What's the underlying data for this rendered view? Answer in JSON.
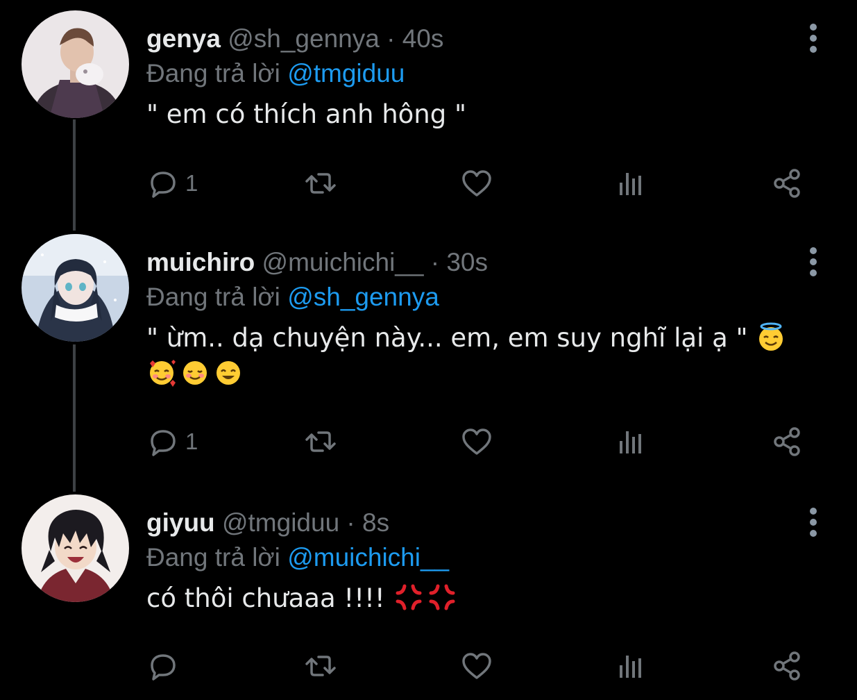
{
  "colors": {
    "background": "#000000",
    "text_primary": "#e7e9ea",
    "text_secondary": "#71767b",
    "accent": "#1d9bf0",
    "thread_line": "#3d4145"
  },
  "tweets": [
    {
      "name": "genya",
      "handle": "@sh_gennya",
      "sep": " · ",
      "time": "40s",
      "replying_label": "Đang trả lời ",
      "replying_to": "@tmgiduu",
      "text": "\" em có thích anh hông \"",
      "emojis": [],
      "reply_count": "1",
      "avatar_icon": "avatar-genya"
    },
    {
      "name": "muichiro",
      "handle": "@muichichi__",
      "sep": " · ",
      "time": "30s",
      "replying_label": "Đang trả lời ",
      "replying_to": "@sh_gennya",
      "text": "\" ừm.. dạ chuyện này... em, em suy nghĩ lại ạ \"",
      "emojis": [
        "smiling-face-with-halo",
        "smiling-face-with-hearts",
        "smiling-face",
        "smiling-face-with-smiling-eyes"
      ],
      "reply_count": "1",
      "avatar_icon": "avatar-muichiro"
    },
    {
      "name": "giyuu",
      "handle": "@tmgiduu",
      "sep": " · ",
      "time": "8s",
      "replying_label": "Đang trả lời ",
      "replying_to": "@muichichi__",
      "text": "có thôi chưaaa !!!!",
      "emojis": [
        "anger-symbol",
        "anger-symbol"
      ],
      "reply_count": "",
      "avatar_icon": "avatar-giyuu"
    }
  ],
  "action_icons": [
    "reply-icon",
    "retweet-icon",
    "like-icon",
    "analytics-icon",
    "share-icon"
  ],
  "menu_icon": "more-options-icon"
}
